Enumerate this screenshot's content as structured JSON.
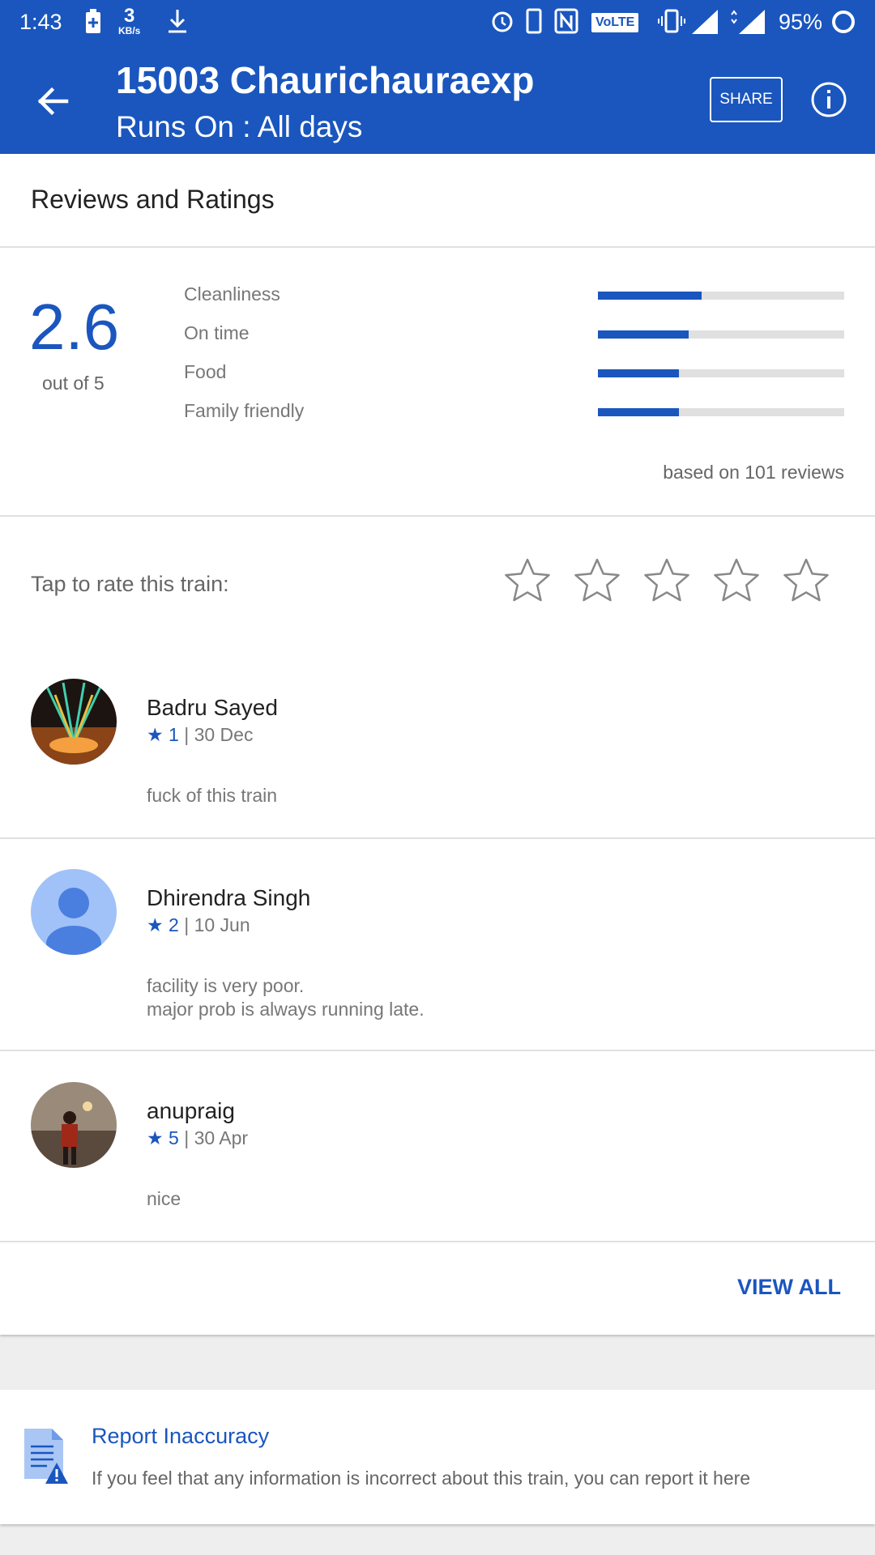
{
  "status_bar": {
    "time": "1:43",
    "speed_value": "3",
    "speed_unit": "KB/s",
    "network": "VoLTE",
    "battery": "95%"
  },
  "app_bar": {
    "title": "15003 Chaurichauraexp",
    "subtitle": "Runs On :  All days",
    "share_label": "SHARE"
  },
  "reviews": {
    "section_title": "Reviews and Ratings",
    "overall_score": "2.6",
    "out_of": "out of 5",
    "categories": [
      {
        "label": "Cleanliness",
        "fraction": 0.42
      },
      {
        "label": "On time",
        "fraction": 0.37
      },
      {
        "label": "Food",
        "fraction": 0.33
      },
      {
        "label": "Family friendly",
        "fraction": 0.33
      }
    ],
    "based_on": "based on 101 reviews",
    "tap_prompt": "Tap to rate this train:",
    "list": [
      {
        "name": "Badru Sayed",
        "stars": "★ 1",
        "date": " | 30 Dec",
        "text_lines": [
          "fuck of this train"
        ]
      },
      {
        "name": "Dhirendra Singh",
        "stars": "★ 2",
        "date": " | 10 Jun",
        "text_lines": [
          "facility is very poor.",
          "major prob is always running late."
        ]
      },
      {
        "name": "anupraig",
        "stars": "★ 5",
        "date": " | 30 Apr",
        "text_lines": [
          "nice"
        ]
      }
    ],
    "view_all": "VIEW ALL"
  },
  "report": {
    "title": "Report Inaccuracy",
    "description": "If you feel that any information is incorrect about this train, you can report it here"
  },
  "colors": {
    "primary": "#1a56be",
    "bar_track": "#e0e0e0"
  }
}
